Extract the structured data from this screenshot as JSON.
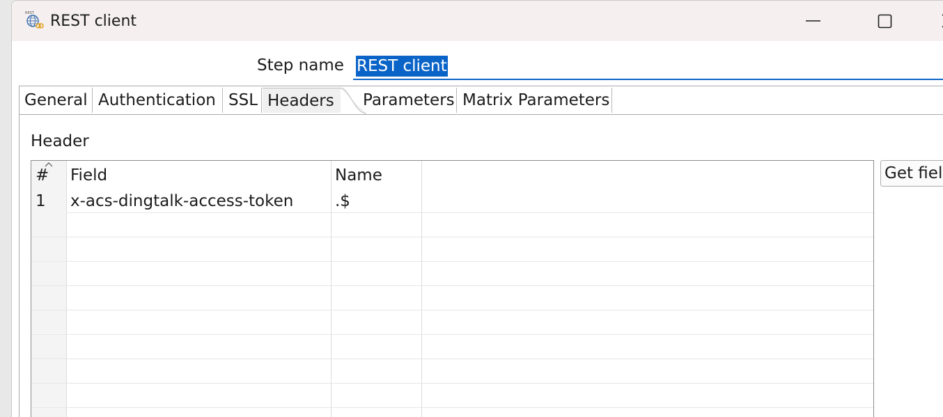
{
  "window": {
    "title": "REST client",
    "icon": "rest-globe-icon"
  },
  "step": {
    "label": "Step name",
    "value": "REST client"
  },
  "tabs": [
    {
      "label": "General"
    },
    {
      "label": "Authentication"
    },
    {
      "label": "SSL"
    },
    {
      "label": "Headers",
      "active": true
    },
    {
      "label": "Parameters"
    },
    {
      "label": "Matrix Parameters"
    }
  ],
  "header_panel": {
    "title": "Header",
    "columns": [
      "#",
      "Field",
      "Name"
    ],
    "rows": [
      {
        "num": "1",
        "field": "x-acs-dingtalk-access-token",
        "name": ".$"
      }
    ],
    "get_fields_label": "Get fields"
  },
  "colors": {
    "accent": "#0a64c8",
    "titlebar": "#f5efef"
  }
}
